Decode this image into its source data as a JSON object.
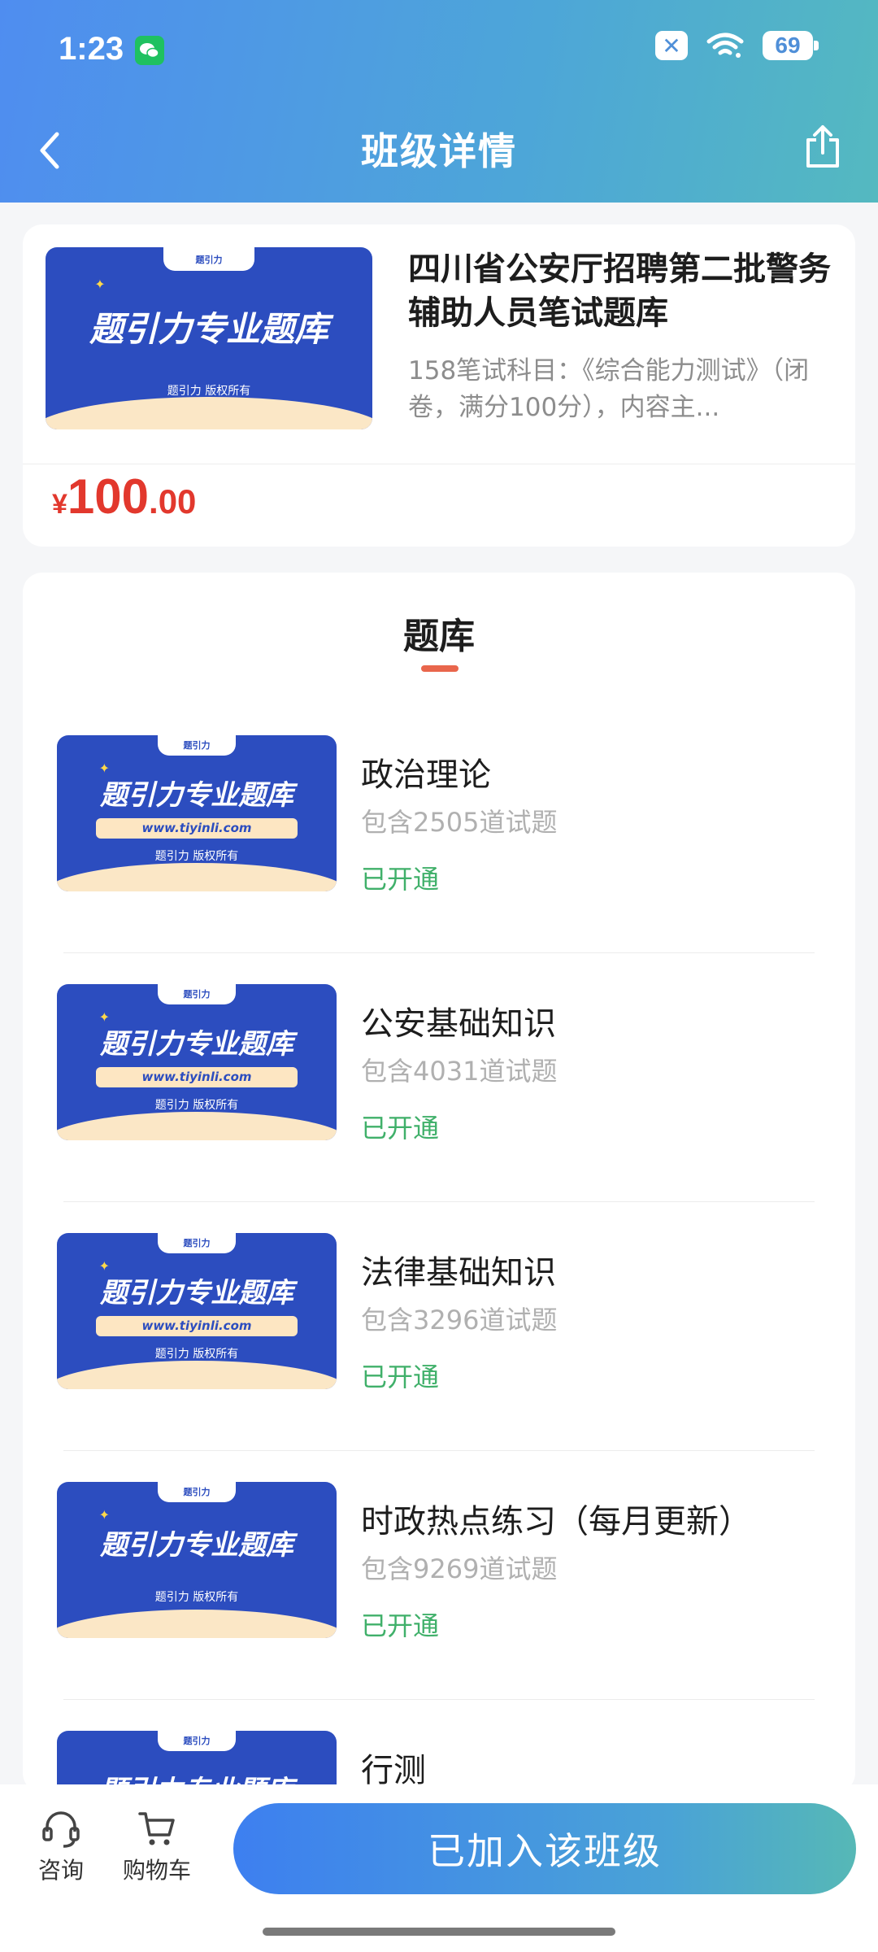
{
  "status_bar": {
    "time": "1:23",
    "battery": "69"
  },
  "header": {
    "title": "班级详情"
  },
  "course": {
    "name": "四川省公安厅招聘第二批警务辅助人员笔试题库",
    "description": "158笔试科目：《综合能力测试》（闭卷，满分100分），内容主...",
    "price": {
      "currency": "¥",
      "integer": "100",
      "decimal": ".00"
    },
    "banner": {
      "brand": "题引力",
      "title": "题引力专业题库",
      "copyright": "题引力 版权所有"
    }
  },
  "bank_section": {
    "title": "题库",
    "items": [
      {
        "name": "政治理论",
        "count": "包含2505道试题",
        "status": "已开通",
        "banner_title": "题引力专业题库",
        "banner_url": "www.tiyinli.com",
        "banner_copy": "题引力 版权所有"
      },
      {
        "name": "公安基础知识",
        "count": "包含4031道试题",
        "status": "已开通",
        "banner_title": "题引力专业题库",
        "banner_url": "www.tiyinli.com",
        "banner_copy": "题引力 版权所有"
      },
      {
        "name": "法律基础知识",
        "count": "包含3296道试题",
        "status": "已开通",
        "banner_title": "题引力专业题库",
        "banner_url": "www.tiyinli.com",
        "banner_copy": "题引力 版权所有"
      },
      {
        "name": "时政热点练习（每月更新）",
        "count": "包含9269道试题",
        "status": "已开通",
        "banner_title": "题引力专业题库",
        "banner_url": "",
        "banner_copy": "题引力 版权所有"
      },
      {
        "name": "行测",
        "count": "",
        "status": "",
        "banner_title": "题引力专业题库",
        "banner_url": "",
        "banner_copy": ""
      }
    ]
  },
  "bottom_bar": {
    "consult_label": "咨询",
    "cart_label": "购物车",
    "join_label": "已加入该班级"
  }
}
